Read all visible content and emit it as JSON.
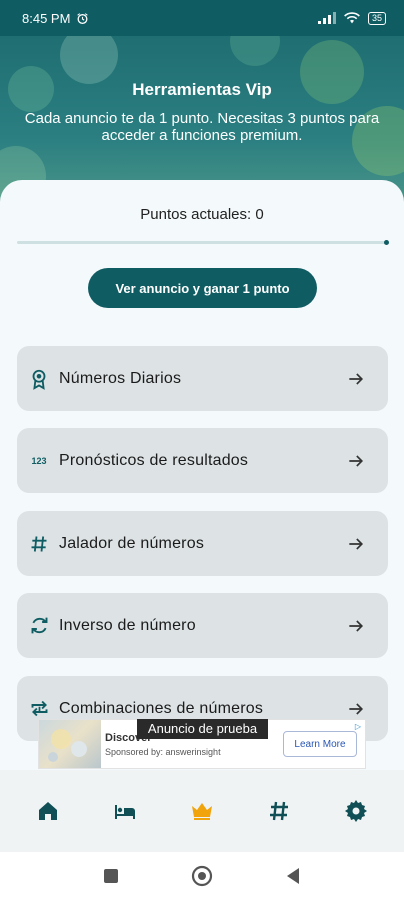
{
  "status_bar": {
    "time": "8:45 PM",
    "battery": "35",
    "icons": [
      "alarm-icon",
      "signal-icon",
      "wifi-icon",
      "battery-icon"
    ]
  },
  "header": {
    "title": "Herramientas Vip",
    "subtitle": "Cada anuncio te da 1 punto. Necesitas 3 puntos para acceder a funciones premium."
  },
  "points": {
    "label": "Puntos actuales: 0",
    "progress": 0
  },
  "watch_ad_button": "Ver anuncio y ganar 1 punto",
  "menu": [
    {
      "label": "Números Diarios",
      "icon": "award-ribbon-icon"
    },
    {
      "label": "Pronósticos de resultados",
      "icon": "numbers-123-icon"
    },
    {
      "label": "Jalador de números",
      "icon": "hashtag-icon"
    },
    {
      "label": "Inverso de número",
      "icon": "sync-icon"
    },
    {
      "label": "Combinaciones de números",
      "icon": "repeat-one-icon"
    }
  ],
  "ad_banner": {
    "test_label": "Anuncio de prueba",
    "headline": "Discover",
    "sponsor": "Sponsored by: answerinsight",
    "cta": "Learn More"
  },
  "bottom_nav": [
    {
      "icon": "home-icon",
      "active": false
    },
    {
      "icon": "bed-icon",
      "active": false
    },
    {
      "icon": "crown-icon",
      "active": true
    },
    {
      "icon": "hashtag-icon",
      "active": false
    },
    {
      "icon": "gear-icon",
      "active": false
    }
  ],
  "colors": {
    "primary": "#0f5d63",
    "active_nav": "#f0a30a",
    "card_background": "#f4f9fb",
    "menu_item_background": "#dde3e5"
  }
}
